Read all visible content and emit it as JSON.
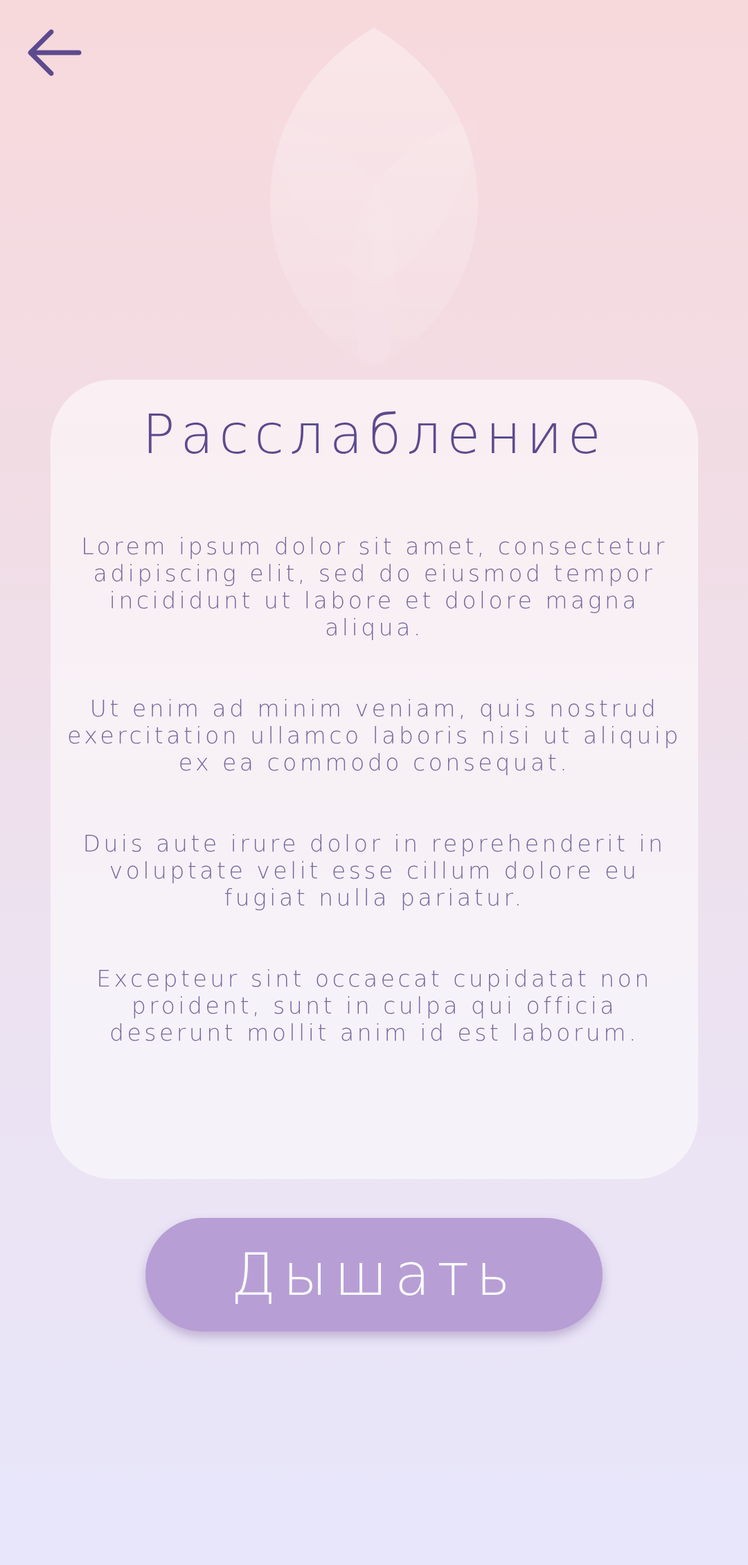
{
  "header": {
    "back_icon": "arrow-left-icon",
    "icon_color": "#5d4a8e"
  },
  "decoration": {
    "icon": "leaf-icon"
  },
  "card": {
    "title": "Расслабление",
    "paragraphs": [
      "Lorem ipsum dolor sit amet, consectetur adipiscing elit, sed do eiusmod tempor incididunt ut labore et dolore magna aliqua.",
      "Ut enim ad minim veniam, quis nostrud exercitation ullamco laboris nisi ut aliquip ex ea commodo consequat.",
      "Duis aute irure dolor in reprehenderit in voluptate velit esse cillum dolore eu fugiat nulla pariatur.",
      "Excepteur sint occaecat cupidatat non proident, sunt in culpa qui officia deserunt mollit anim id est laborum."
    ]
  },
  "action": {
    "breathe_label": "Дышать",
    "button_color": "#b79fd5"
  }
}
